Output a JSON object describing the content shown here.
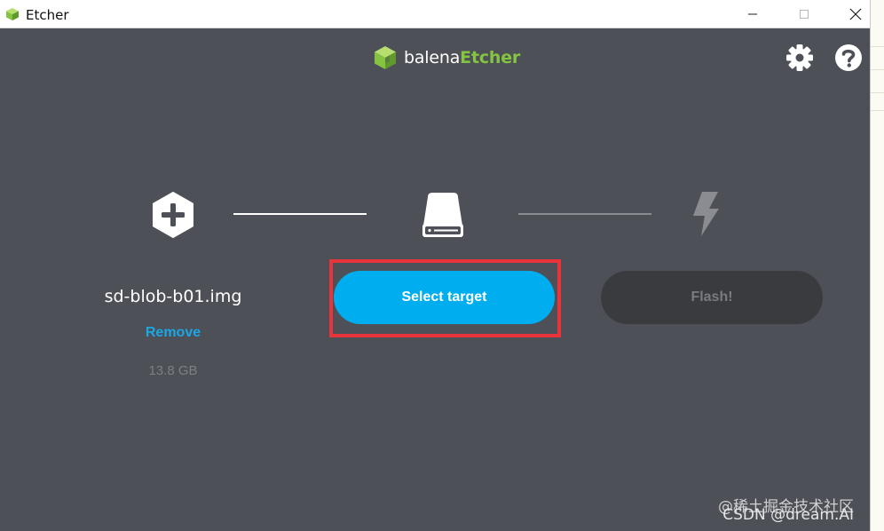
{
  "window": {
    "title": "Etcher"
  },
  "logo": {
    "part1": "balena",
    "part2": "Etcher",
    "accent_color": "#85c342"
  },
  "steps": {
    "image": {
      "icon": "plus-hexagon-icon",
      "file_name": "sd-blob-b01.img",
      "remove_label": "Remove",
      "size": "13.8 GB"
    },
    "target": {
      "icon": "drive-icon",
      "button_label": "Select target",
      "button_color": "#00aeef"
    },
    "flash": {
      "icon": "lightning-icon",
      "button_label": "Flash!"
    }
  },
  "watermark": {
    "line1": "@稀土掘金技术社区",
    "line2": "CSDN @dream.AI"
  }
}
